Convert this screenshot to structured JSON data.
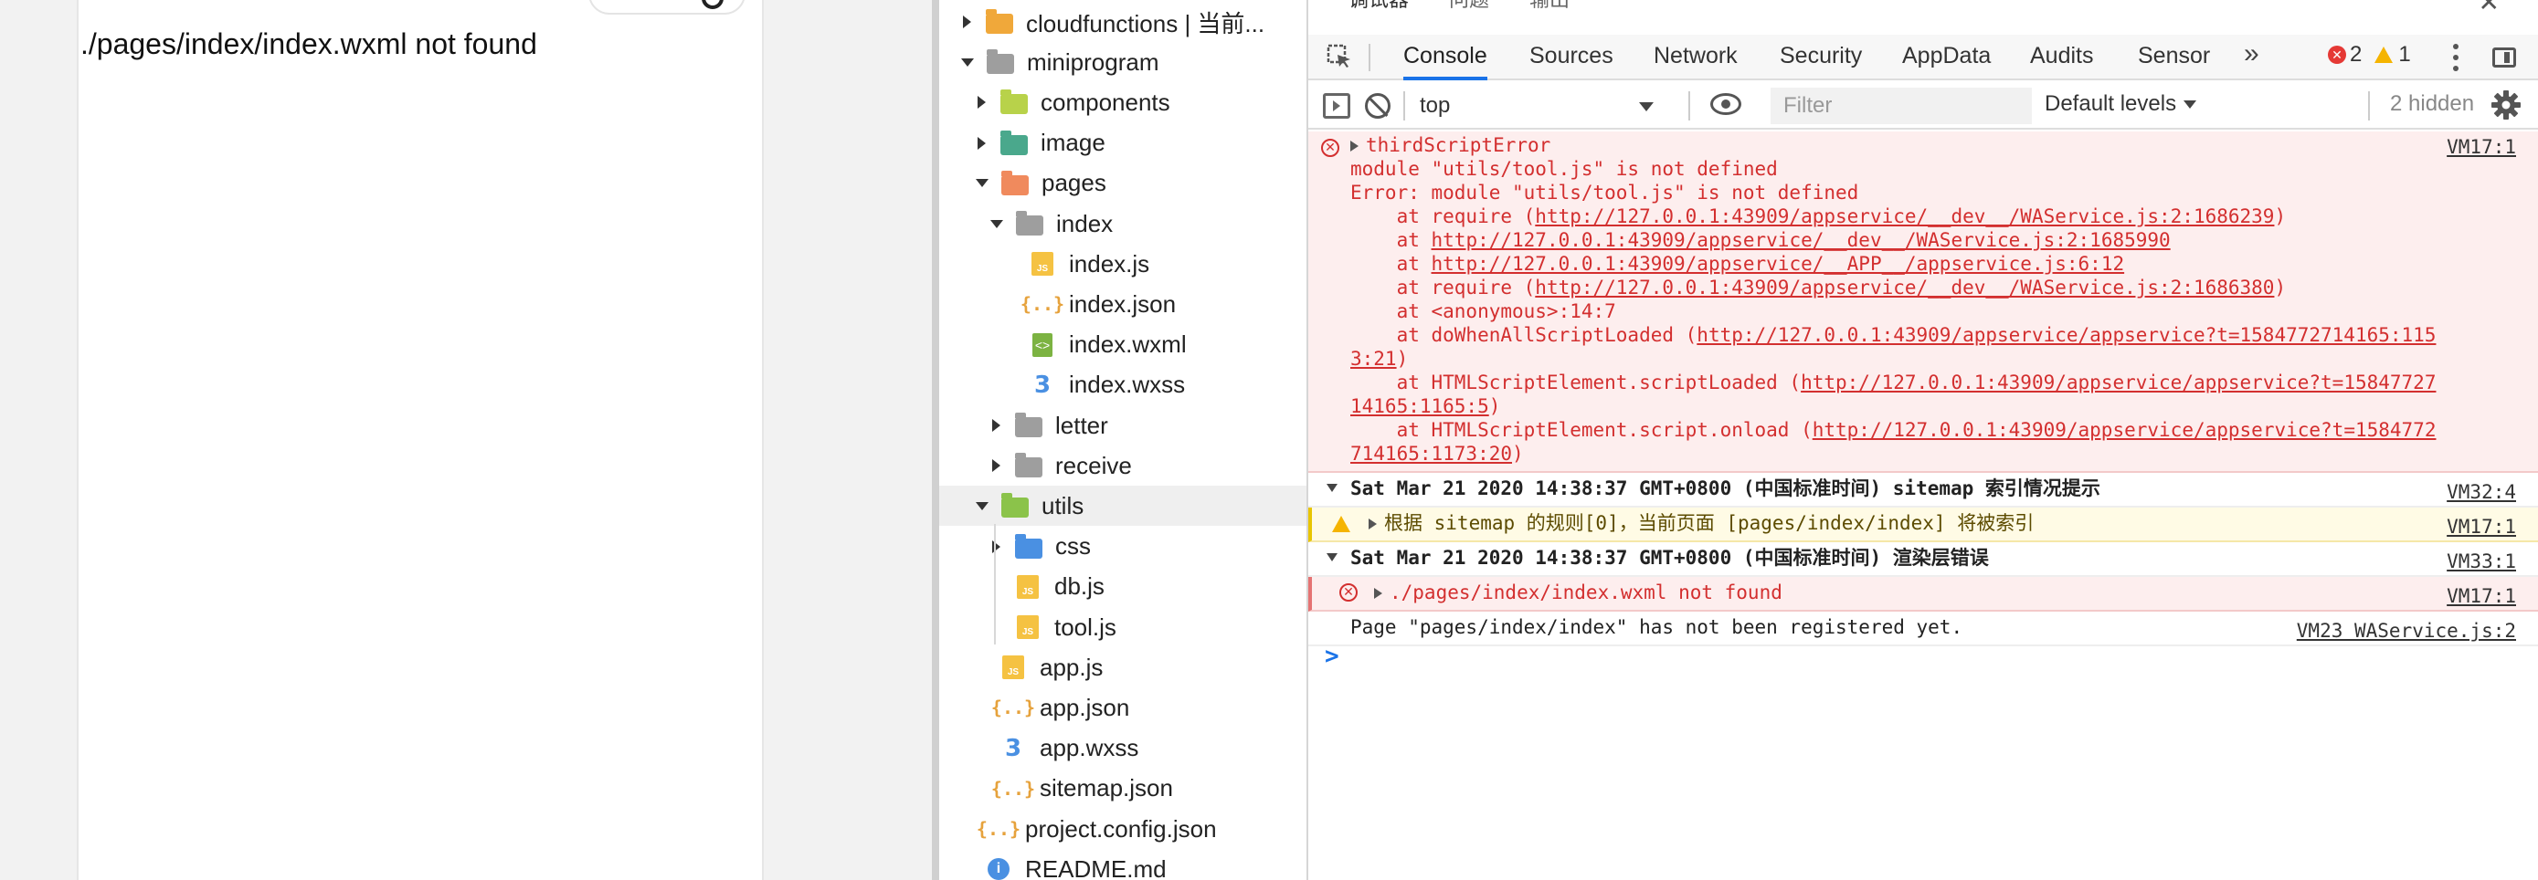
{
  "simulator": {
    "error_text": "./pages/index/index.wxml not found"
  },
  "file_tree": [
    {
      "label": "cloudfunctions | 当前...",
      "icon": "folder-cloud-icon",
      "color": "#f0a83a",
      "depth": 0,
      "arrow": "right"
    },
    {
      "label": "miniprogram",
      "icon": "folder-open-icon",
      "color": "#9e9e9e",
      "depth": 0,
      "arrow": "down"
    },
    {
      "label": "components",
      "icon": "folder-components-icon",
      "color": "#b8d24a",
      "depth": 1,
      "arrow": "right"
    },
    {
      "label": "image",
      "icon": "folder-image-icon",
      "color": "#4aa88c",
      "depth": 1,
      "arrow": "right"
    },
    {
      "label": "pages",
      "icon": "folder-pages-icon",
      "color": "#f08a5d",
      "depth": 1,
      "arrow": "down"
    },
    {
      "label": "index",
      "icon": "folder-open-icon",
      "color": "#9e9e9e",
      "depth": 2,
      "arrow": "down"
    },
    {
      "label": "index.js",
      "icon": "js-file-icon",
      "depth": 3,
      "arrow": "none"
    },
    {
      "label": "index.json",
      "icon": "json-file-icon",
      "depth": 3,
      "arrow": "none"
    },
    {
      "label": "index.wxml",
      "icon": "wxml-file-icon",
      "depth": 3,
      "arrow": "none"
    },
    {
      "label": "index.wxss",
      "icon": "wxss-file-icon",
      "depth": 3,
      "arrow": "none"
    },
    {
      "label": "letter",
      "icon": "folder-icon",
      "color": "#9e9e9e",
      "depth": 2,
      "arrow": "right"
    },
    {
      "label": "receive",
      "icon": "folder-icon",
      "color": "#9e9e9e",
      "depth": 2,
      "arrow": "right"
    },
    {
      "label": "utils",
      "icon": "folder-utils-icon",
      "color": "#8bc34a",
      "depth": 1,
      "arrow": "down",
      "selected": true
    },
    {
      "label": "css",
      "icon": "folder-css-icon",
      "color": "#4a90e2",
      "depth": 2,
      "arrow": "right"
    },
    {
      "label": "db.js",
      "icon": "js-file-icon",
      "depth": 2,
      "arrow": "none"
    },
    {
      "label": "tool.js",
      "icon": "js-file-icon",
      "depth": 2,
      "arrow": "none"
    },
    {
      "label": "app.js",
      "icon": "js-file-icon",
      "depth": 1,
      "arrow": "none"
    },
    {
      "label": "app.json",
      "icon": "json-file-icon",
      "depth": 1,
      "arrow": "none"
    },
    {
      "label": "app.wxss",
      "icon": "wxss-file-icon",
      "depth": 1,
      "arrow": "none"
    },
    {
      "label": "sitemap.json",
      "icon": "json-file-icon",
      "depth": 1,
      "arrow": "none"
    },
    {
      "label": "project.config.json",
      "icon": "json-file-icon",
      "depth": 0,
      "arrow": "none"
    },
    {
      "label": "README.md",
      "icon": "info-icon",
      "depth": 0,
      "arrow": "none"
    }
  ],
  "devtools": {
    "top_tabs": [
      "调试器",
      "问题",
      "输出"
    ],
    "tabs": [
      "Console",
      "Sources",
      "Network",
      "Security",
      "AppData",
      "Audits",
      "Sensor"
    ],
    "active_tab": "Console",
    "error_count": "2",
    "warning_count": "1",
    "context": "top",
    "filter_placeholder": "Filter",
    "levels": "Default levels",
    "hidden": "2 hidden"
  },
  "console": {
    "error1": {
      "title": "thirdScriptError",
      "source": "VM17:1",
      "lines": [
        "module \"utils/tool.js\" is not defined",
        "Error: module \"utils/tool.js\" is not defined"
      ],
      "stack": [
        {
          "pre": "    at require (",
          "link": "http://127.0.0.1:43909/appservice/__dev__/WAService.js:2:1686239",
          "post": ")"
        },
        {
          "pre": "    at ",
          "link": "http://127.0.0.1:43909/appservice/__dev__/WAService.js:2:1685990",
          "post": ""
        },
        {
          "pre": "    at ",
          "link": "http://127.0.0.1:43909/appservice/__APP__/appservice.js:6:12",
          "post": ""
        },
        {
          "pre": "    at require (",
          "link": "http://127.0.0.1:43909/appservice/__dev__/WAService.js:2:1686380",
          "post": ")"
        },
        {
          "pre": "    at <anonymous>:14:7",
          "link": "",
          "post": ""
        },
        {
          "pre": "    at doWhenAllScriptLoaded (",
          "link": "http://127.0.0.1:43909/appservice/appservice?t=1584772714165:115",
          "post": ""
        },
        {
          "pre": "",
          "link": "3:21",
          "post": ")"
        },
        {
          "pre": "    at HTMLScriptElement.scriptLoaded (",
          "link": "http://127.0.0.1:43909/appservice/appservice?t=15847727",
          "post": ""
        },
        {
          "pre": "",
          "link": "14165:1165:5",
          "post": ")"
        },
        {
          "pre": "    at HTMLScriptElement.script.onload (",
          "link": "http://127.0.0.1:43909/appservice/appservice?t=1584772",
          "post": ""
        },
        {
          "pre": "",
          "link": "714165:1173:20",
          "post": ")"
        }
      ]
    },
    "group1": {
      "title": "Sat Mar 21 2020 14:38:37 GMT+0800 (中国标准时间) sitemap 索引情况提示",
      "source": "VM32:4"
    },
    "warn1": {
      "text": "根据 sitemap 的规则[0]，当前页面 [pages/index/index] 将被索引",
      "source": "VM17:1"
    },
    "group2": {
      "title": "Sat Mar 21 2020 14:38:37 GMT+0800 (中国标准时间) 渲染层错误",
      "source": "VM33:1"
    },
    "error2": {
      "text": "./pages/index/index.wxml not found",
      "source": "VM17:1"
    },
    "log1": {
      "text": "Page \"pages/index/index\" has not been registered yet.",
      "source": "VM23 WAService.js:2"
    },
    "prompt": ">"
  }
}
